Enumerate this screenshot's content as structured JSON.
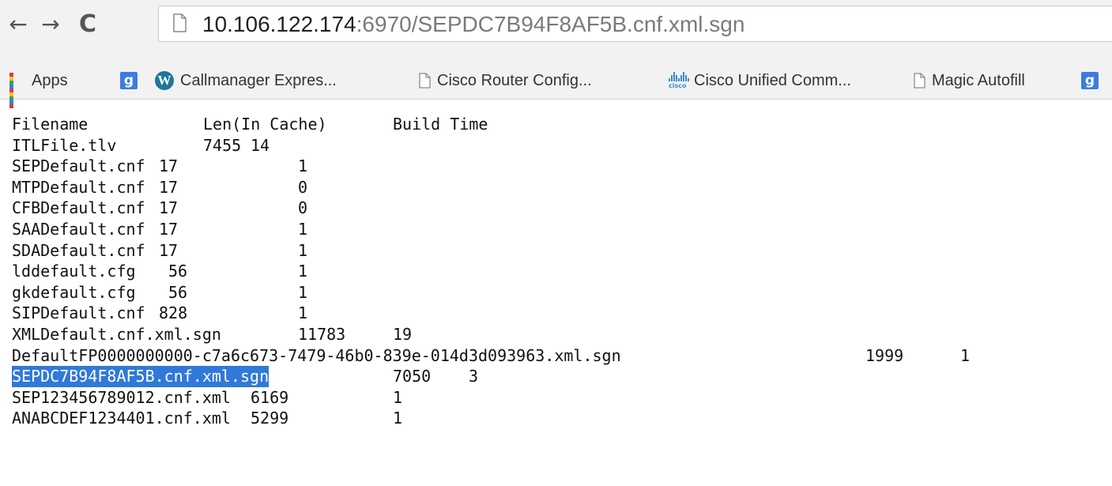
{
  "browser": {
    "url_host": "10.106.122.174",
    "url_rest": ":6970/SEPDC7B94F8AF5B.cnf.xml.sgn"
  },
  "bookmarks": [
    {
      "label": "Apps",
      "icon": "apps-grid-icon"
    },
    {
      "label": "",
      "icon": "google-plus-icon"
    },
    {
      "label": "Callmanager Expres...",
      "icon": "wordpress-icon"
    },
    {
      "label": "Cisco Router Config...",
      "icon": "page-icon"
    },
    {
      "label": "Cisco Unified Comm...",
      "icon": "cisco-icon"
    },
    {
      "label": "Magic Autofill",
      "icon": "page-icon"
    },
    {
      "label": "",
      "icon": "google-plus-icon"
    }
  ],
  "listing": {
    "header": [
      "Filename",
      "Len(In Cache)",
      "Build Time"
    ],
    "rows": [
      [
        "ITLFile.tlv",
        "7455",
        "14"
      ],
      [
        "SEPDefault.cnf",
        "17",
        "1"
      ],
      [
        "MTPDefault.cnf",
        "17",
        "0"
      ],
      [
        "CFBDefault.cnf",
        "17",
        "0"
      ],
      [
        "SAADefault.cnf",
        "17",
        "1"
      ],
      [
        "SDADefault.cnf",
        "17",
        "1"
      ],
      [
        "lddefault.cfg",
        "56",
        "1"
      ],
      [
        "gkdefault.cfg",
        "56",
        "1"
      ],
      [
        "SIPDefault.cnf",
        "828",
        "1"
      ],
      [
        "XMLDefault.cnf.xml.sgn",
        "11783",
        "19"
      ],
      [
        "DefaultFP0000000000-c7a6c673-7479-46b0-839e-014d3d093963.xml.sgn",
        "1999",
        "1"
      ],
      [
        "SEPDC7B94F8AF5B.cnf.xml.sgn",
        "7050",
        "3"
      ],
      [
        "SEP123456789012.cnf.xml",
        "6169",
        "1"
      ],
      [
        "ANABCDEF1234401.cnf.xml",
        "5299",
        "1"
      ]
    ],
    "selected_row": "SEPDC7B94F8AF5B.cnf.xml.sgn"
  }
}
